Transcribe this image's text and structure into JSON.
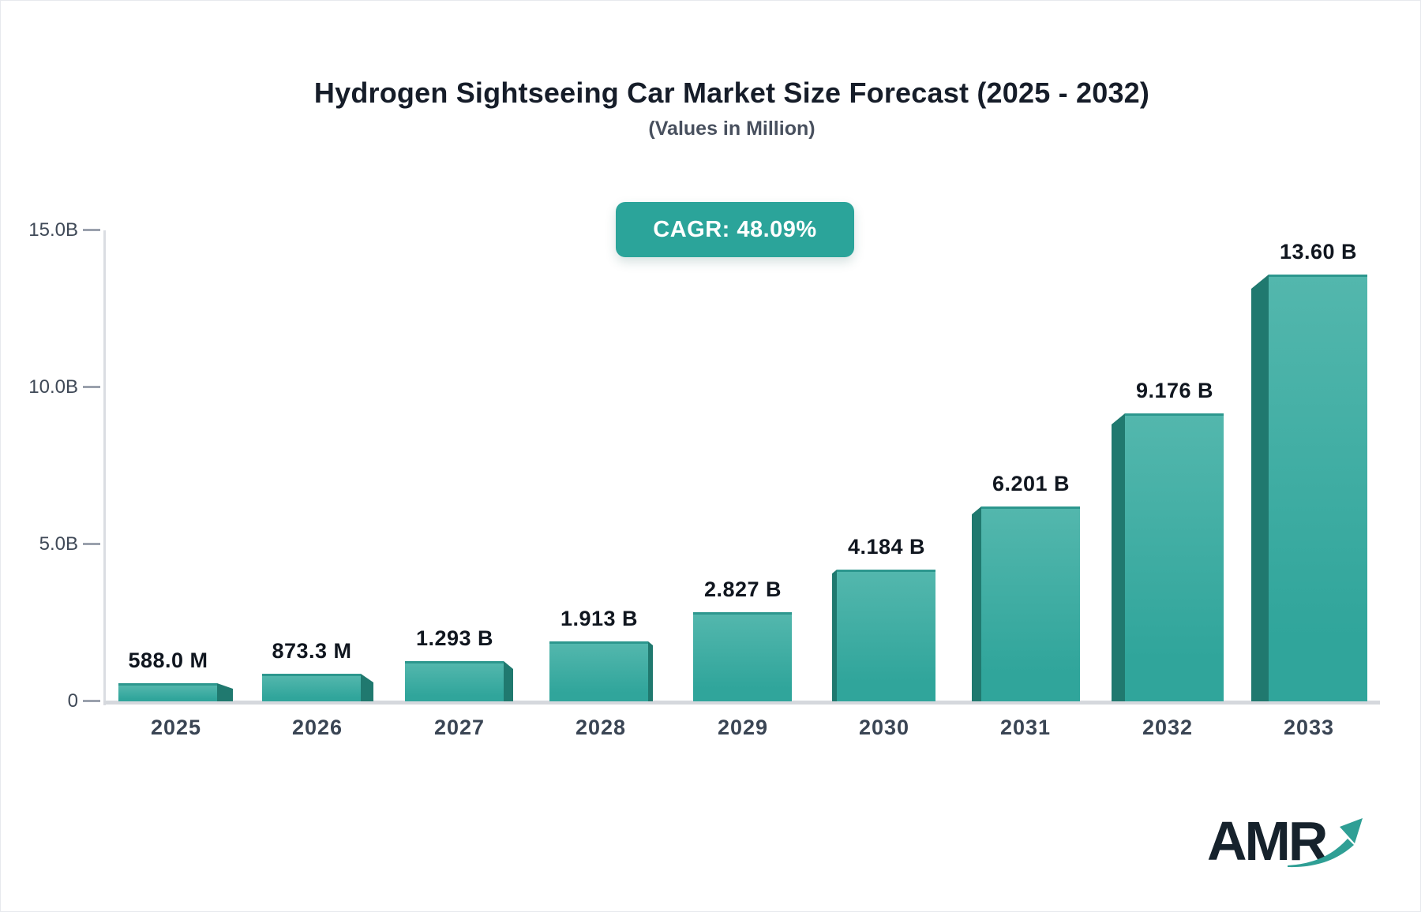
{
  "title": "Hydrogen Sightseeing Car Market Size Forecast (2025 - 2032)",
  "subtitle": "(Values in Million)",
  "badge": {
    "label": "CAGR: 48.09%",
    "bg_color": "#2ba49a",
    "text_color": "#ffffff"
  },
  "logo": {
    "text": "AMR",
    "arrow_icon": "upward-trend-arrow",
    "text_color": "#16222c",
    "arrow_color": "#2f9f95"
  },
  "chart_data": {
    "type": "bar",
    "title": "Hydrogen Sightseeing Car Market Size Forecast (2025 - 2032)",
    "subtitle": "(Values in Million)",
    "cagr_annotation": "CAGR: 48.09%",
    "categories": [
      "2025",
      "2026",
      "2027",
      "2028",
      "2029",
      "2030",
      "2031",
      "2032",
      "2033"
    ],
    "values_in_millions": [
      588.0,
      873.3,
      1293,
      1913,
      2827,
      4184,
      6201,
      9176,
      13600
    ],
    "values_in_billions": [
      0.588,
      0.8733,
      1.293,
      1.913,
      2.827,
      4.184,
      6.201,
      9.176,
      13.6
    ],
    "value_labels": [
      "588.0 M",
      "873.3 M",
      "1.293 B",
      "1.913 B",
      "2.827 B",
      "4.184 B",
      "6.201 B",
      "9.176 B",
      "13.60 B"
    ],
    "xlabel": "",
    "ylabel": "",
    "ylim_billions": [
      0,
      15
    ],
    "ytick_values_billions": [
      0,
      5,
      10,
      15
    ],
    "ytick_labels": [
      "0",
      "5.0B",
      "10.0B",
      "15.0B"
    ],
    "grid": "off",
    "legend": "none",
    "colors": {
      "bar_face_top": "#53b7ad",
      "bar_face_bottom": "#30a59b",
      "bar_top_edge": "#2d978e",
      "bar_side_3d": "#20796f",
      "axis_line": "#dadde2",
      "baseline": "#d5d8dd",
      "tick": "#9aa1ad",
      "axis_text": "#3f4957",
      "category_text": "#3a4554",
      "value_text": "#10161f"
    }
  }
}
